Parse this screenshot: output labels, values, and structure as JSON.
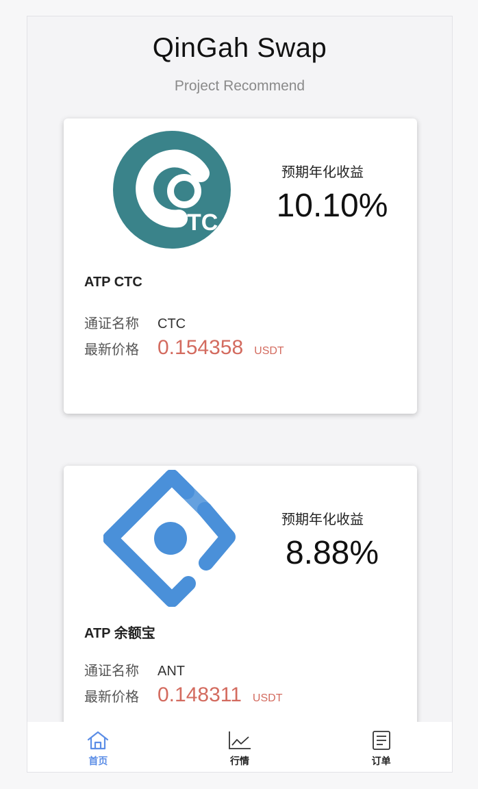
{
  "header": {
    "title": "QinGah Swap",
    "subtitle": "Project Recommend"
  },
  "projects": [
    {
      "logo_icon": "ctc-logo-icon",
      "yield_label": "预期年化收益",
      "yield_value": "10.10%",
      "name": "ATP CTC",
      "token_label": "通证名称",
      "token_value": "CTC",
      "price_label": "最新价格",
      "price_value": "0.154358",
      "price_unit": "USDT"
    },
    {
      "logo_icon": "ant-logo-icon",
      "yield_label": "预期年化收益",
      "yield_value": "8.88%",
      "name": "ATP 余额宝",
      "token_label": "通证名称",
      "token_value": "ANT",
      "price_label": "最新价格",
      "price_value": "0.148311",
      "price_unit": "USDT"
    }
  ],
  "tabbar": {
    "items": [
      {
        "label": "首页",
        "icon": "home-icon",
        "active": true
      },
      {
        "label": "行情",
        "icon": "chart-line-icon",
        "active": false
      },
      {
        "label": "订单",
        "icon": "document-icon",
        "active": false
      }
    ]
  },
  "colors": {
    "accent": "#5b8de6",
    "price": "#d36b5f",
    "ctc_teal": "#3a838a",
    "ant_blue": "#4a90d9"
  }
}
